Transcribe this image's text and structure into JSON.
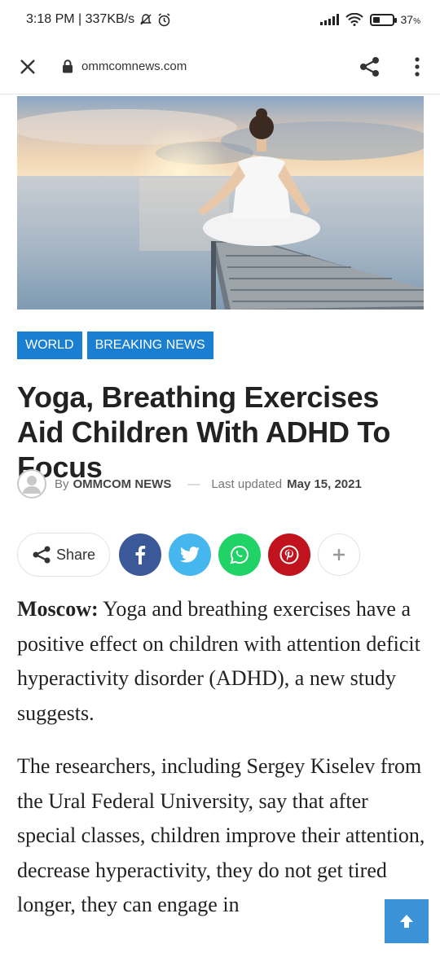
{
  "status_bar": {
    "time_info": "3:18 PM | 337KB/s",
    "battery": "37",
    "battery_unit": "%",
    "battery_level": 0.37
  },
  "browser": {
    "url": "ommcomnews.com",
    "icons": [
      "close-icon",
      "lock-icon",
      "share-icon",
      "more-vert-icon"
    ]
  },
  "hero": {
    "icon": "yoga-photo"
  },
  "tags": [
    "WORLD",
    "BREAKING NEWS"
  ],
  "article": {
    "title": "Yoga, Breathing Exercises Aid Children With ADHD To Focus",
    "by_label": "By",
    "author": "OMMCOM NEWS",
    "dash": "—",
    "updated_label": "Last updated",
    "date": "May 15, 2021",
    "share_label": "Share",
    "social": [
      {
        "name": "facebook",
        "glyph": "f",
        "color": "#3b5998"
      },
      {
        "name": "twitter",
        "glyph": "twitter",
        "color": "#46b6ee"
      },
      {
        "name": "whatsapp",
        "glyph": "whatsapp",
        "color": "#21d366"
      },
      {
        "name": "pinterest",
        "glyph": "P",
        "color": "#c0131d"
      },
      {
        "name": "more",
        "glyph": "+",
        "color": "#ffffff"
      }
    ],
    "p1_lead": "Moscow:",
    "p1_body": " Yoga and breathing exercises have a positive effect on children with attention deficit hyperactivity disorder (ADHD), a new study suggests.",
    "p2": "The researchers, including Sergey Kiselev from the Ural Federal University, say that after special classes, children improve their attention, decrease hyperactivity, they do not get tired longer, they can engage in"
  },
  "colors": {
    "accent": "#1a7fd0"
  }
}
